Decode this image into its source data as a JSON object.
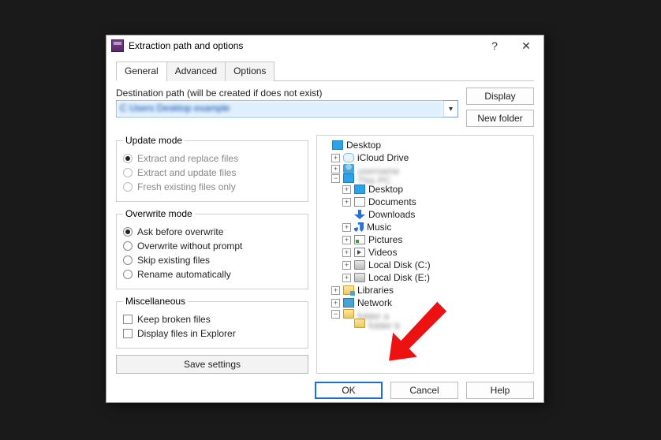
{
  "title": "Extraction path and options",
  "tabs": {
    "general": "General",
    "advanced": "Advanced",
    "options": "Options"
  },
  "dest_label": "Destination path (will be created if does not exist)",
  "buttons": {
    "display": "Display",
    "newfolder": "New folder",
    "save": "Save settings",
    "ok": "OK",
    "cancel": "Cancel",
    "help": "Help"
  },
  "update": {
    "legend": "Update mode",
    "replace": "Extract and replace files",
    "update": "Extract and update files",
    "fresh": "Fresh existing files only"
  },
  "overwrite": {
    "legend": "Overwrite mode",
    "ask": "Ask before overwrite",
    "noprompt": "Overwrite without prompt",
    "skip": "Skip existing files",
    "rename": "Rename automatically"
  },
  "misc": {
    "legend": "Miscellaneous",
    "broken": "Keep broken files",
    "explorer": "Display files in Explorer"
  },
  "tree": {
    "desktop": "Desktop",
    "icloud": "iCloud Drive",
    "desktop2": "Desktop",
    "documents": "Documents",
    "downloads": "Downloads",
    "music": "Music",
    "pictures": "Pictures",
    "videos": "Videos",
    "diskc": "Local Disk (C:)",
    "diske": "Local Disk (E:)",
    "libraries": "Libraries",
    "network": "Network"
  }
}
